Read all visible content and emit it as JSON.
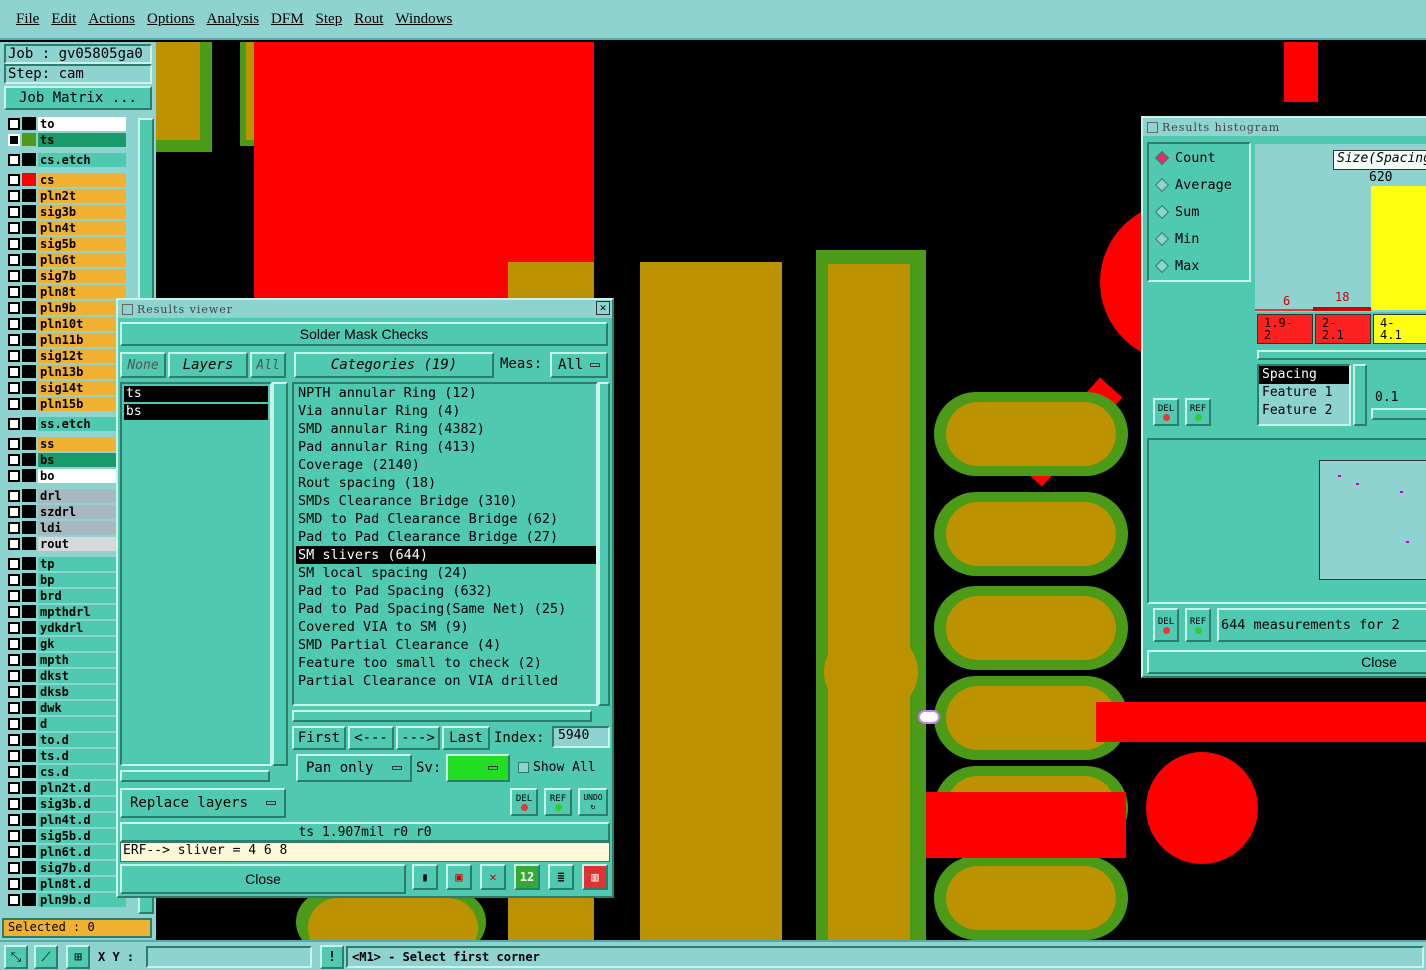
{
  "menu": [
    "File",
    "Edit",
    "Actions",
    "Options",
    "Analysis",
    "DFM",
    "Step",
    "Rout",
    "Windows"
  ],
  "job": {
    "job_label": "Job : gv05805ga0",
    "step_label": "Step: cam",
    "matrix_button": "Job Matrix ..."
  },
  "layers": [
    {
      "name": "to",
      "color": "#ffffff"
    },
    {
      "name": "ts",
      "color": "#1a9a6a"
    },
    {
      "name": "cs.etch",
      "color": "#4fc9b0"
    },
    {
      "name": "cs",
      "color": "#f0b030"
    },
    {
      "name": "pln2t",
      "color": "#f0b030"
    },
    {
      "name": "sig3b",
      "color": "#f0b030"
    },
    {
      "name": "pln4t",
      "color": "#f0b030"
    },
    {
      "name": "sig5b",
      "color": "#f0b030"
    },
    {
      "name": "pln6t",
      "color": "#f0b030"
    },
    {
      "name": "sig7b",
      "color": "#f0b030"
    },
    {
      "name": "pln8t",
      "color": "#f0b030"
    },
    {
      "name": "pln9b",
      "color": "#f0b030"
    },
    {
      "name": "pln10t",
      "color": "#f0b030"
    },
    {
      "name": "pln11b",
      "color": "#f0b030"
    },
    {
      "name": "sig12t",
      "color": "#f0b030"
    },
    {
      "name": "pln13b",
      "color": "#f0b030"
    },
    {
      "name": "sig14t",
      "color": "#f0b030"
    },
    {
      "name": "pln15b",
      "color": "#f0b030"
    },
    {
      "name": "ss.etch",
      "color": "#4fc9b0"
    },
    {
      "name": "ss",
      "color": "#f0b030"
    },
    {
      "name": "bs",
      "color": "#1a9a6a"
    },
    {
      "name": "bo",
      "color": "#ffffff"
    },
    {
      "name": "drl",
      "color": "#a8b8c0"
    },
    {
      "name": "szdrl",
      "color": "#a8b8c0"
    },
    {
      "name": "ldi",
      "color": "#a8b8c0"
    },
    {
      "name": "rout",
      "color": "#d8d8d8"
    },
    {
      "name": "tp",
      "color": "#4fc9b0"
    },
    {
      "name": "bp",
      "color": "#4fc9b0"
    },
    {
      "name": "brd",
      "color": "#4fc9b0"
    },
    {
      "name": "mpthdrl",
      "color": "#4fc9b0"
    },
    {
      "name": "ydkdrl",
      "color": "#4fc9b0"
    },
    {
      "name": "gk",
      "color": "#4fc9b0"
    },
    {
      "name": "mpth",
      "color": "#4fc9b0"
    },
    {
      "name": "dkst",
      "color": "#4fc9b0"
    },
    {
      "name": "dksb",
      "color": "#4fc9b0"
    },
    {
      "name": "dwk",
      "color": "#4fc9b0"
    },
    {
      "name": "d",
      "color": "#4fc9b0"
    },
    {
      "name": "to.d",
      "color": "#4fc9b0"
    },
    {
      "name": "ts.d",
      "color": "#4fc9b0"
    },
    {
      "name": "cs.d",
      "color": "#4fc9b0"
    },
    {
      "name": "pln2t.d",
      "color": "#4fc9b0"
    },
    {
      "name": "sig3b.d",
      "color": "#4fc9b0"
    },
    {
      "name": "pln4t.d",
      "color": "#4fc9b0"
    },
    {
      "name": "sig5b.d",
      "color": "#4fc9b0"
    },
    {
      "name": "pln6t.d",
      "color": "#4fc9b0"
    },
    {
      "name": "sig7b.d",
      "color": "#4fc9b0"
    },
    {
      "name": "pln8t.d",
      "color": "#4fc9b0"
    },
    {
      "name": "pln9b.d",
      "color": "#4fc9b0"
    }
  ],
  "selected_label": "Selected : 0",
  "results_viewer": {
    "title": "Results viewer",
    "header": "Solder Mask Checks",
    "none": "None",
    "layers": "Layers",
    "all": "All",
    "layer_list": [
      "ts",
      "bs"
    ],
    "categories_label": "Categories (19)",
    "meas_label": "Meas:",
    "meas_value": "All",
    "categories": [
      "NPTH annular Ring (12)",
      "Via annular Ring (4)",
      "SMD annular Ring (4382)",
      "Pad annular Ring (413)",
      "Coverage (2140)",
      "Rout spacing (18)",
      "SMDs Clearance Bridge (310)",
      "SMD to Pad Clearance Bridge (62)",
      "Pad to Pad Clearance Bridge (27)",
      "SM slivers (644)",
      "SM local spacing (24)",
      "Pad to Pad Spacing (632)",
      "Pad to Pad Spacing(Same Net) (25)",
      "Covered VIA to SM (9)",
      "SMD Partial Clearance (4)",
      "Feature too small to check (2)",
      "Partial Clearance on VIA drilled"
    ],
    "selected_index": 9,
    "first": "First",
    "prev": "<---",
    "next": "--->",
    "last": "Last",
    "index_label": "Index:",
    "index_value": "5940",
    "pan": "Pan only",
    "sv": "Sv:",
    "show_all": "Show All",
    "replace": "Replace layers",
    "del": "DEL",
    "ref": "REF",
    "undo": "UNDO",
    "info": "ts 1.907mil  r0  r0",
    "erf": "ERF--> sliver = 4 6 8",
    "close": "Close"
  },
  "histogram": {
    "title": "Results histogram",
    "modes": [
      "Count",
      "Average",
      "Sum",
      "Min",
      "Max"
    ],
    "mode_selected": 0,
    "size_label": "Size(Spacing",
    "bars": [
      {
        "label": "1.9-\n2",
        "count": "6"
      },
      {
        "label": "2-\n2.1",
        "count": "18"
      },
      {
        "label": "4-\n4.1",
        "count": "620"
      }
    ],
    "field_list": [
      "Spacing",
      "Feature 1",
      "Feature 2"
    ],
    "field_value": "0.1",
    "measurements": "644 measurements for 2",
    "close": "Close"
  },
  "status": {
    "xy": "X Y :",
    "message": "<M1> - Select first corner"
  },
  "colors": {
    "panel": "#4fc9b0",
    "bg": "#8fd3d0",
    "copper": "#bd9200",
    "mask": "#4b9a18",
    "signal": "#ff0000"
  }
}
